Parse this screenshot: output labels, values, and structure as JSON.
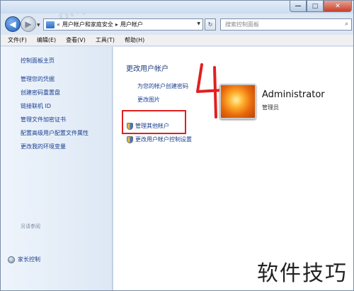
{
  "watermark": {
    "top_text": "ohp",
    "logo_text": "软件技巧"
  },
  "window": {
    "controls": {
      "minimize": "—",
      "maximize": "□",
      "close": "✕"
    }
  },
  "nav": {
    "back_glyph": "◀",
    "forward_glyph": "▶",
    "address": {
      "prefix": "«",
      "crumbs": [
        "用户帐户和家庭安全",
        "用户帐户"
      ],
      "separator": "▸"
    },
    "refresh_glyph": "↻",
    "search": {
      "placeholder": "搜索控制面板",
      "icon": "search-icon"
    }
  },
  "menu": [
    "文件(F)",
    "编辑(E)",
    "查看(V)",
    "工具(T)",
    "帮助(H)"
  ],
  "sidebar": {
    "links": [
      "控制面板主页",
      "管理您的凭据",
      "创建密码重置盘",
      "链接联机 ID",
      "管理文件加密证书",
      "配置高级用户配置文件属性",
      "更改我的环境变量"
    ],
    "see_also": "另请参阅",
    "family_safety": "家长控制"
  },
  "main": {
    "title": "更改用户帐户",
    "links": {
      "create_password": "为您的帐户创建密码",
      "change_picture": "更改图片",
      "manage_other": "管理其他帐户",
      "uac_settings": "更改用户帐户控制设置"
    },
    "account": {
      "name": "Administrator",
      "role": "管理员"
    }
  },
  "colors": {
    "link": "#1a3f8f",
    "annotation": "#e02020"
  }
}
